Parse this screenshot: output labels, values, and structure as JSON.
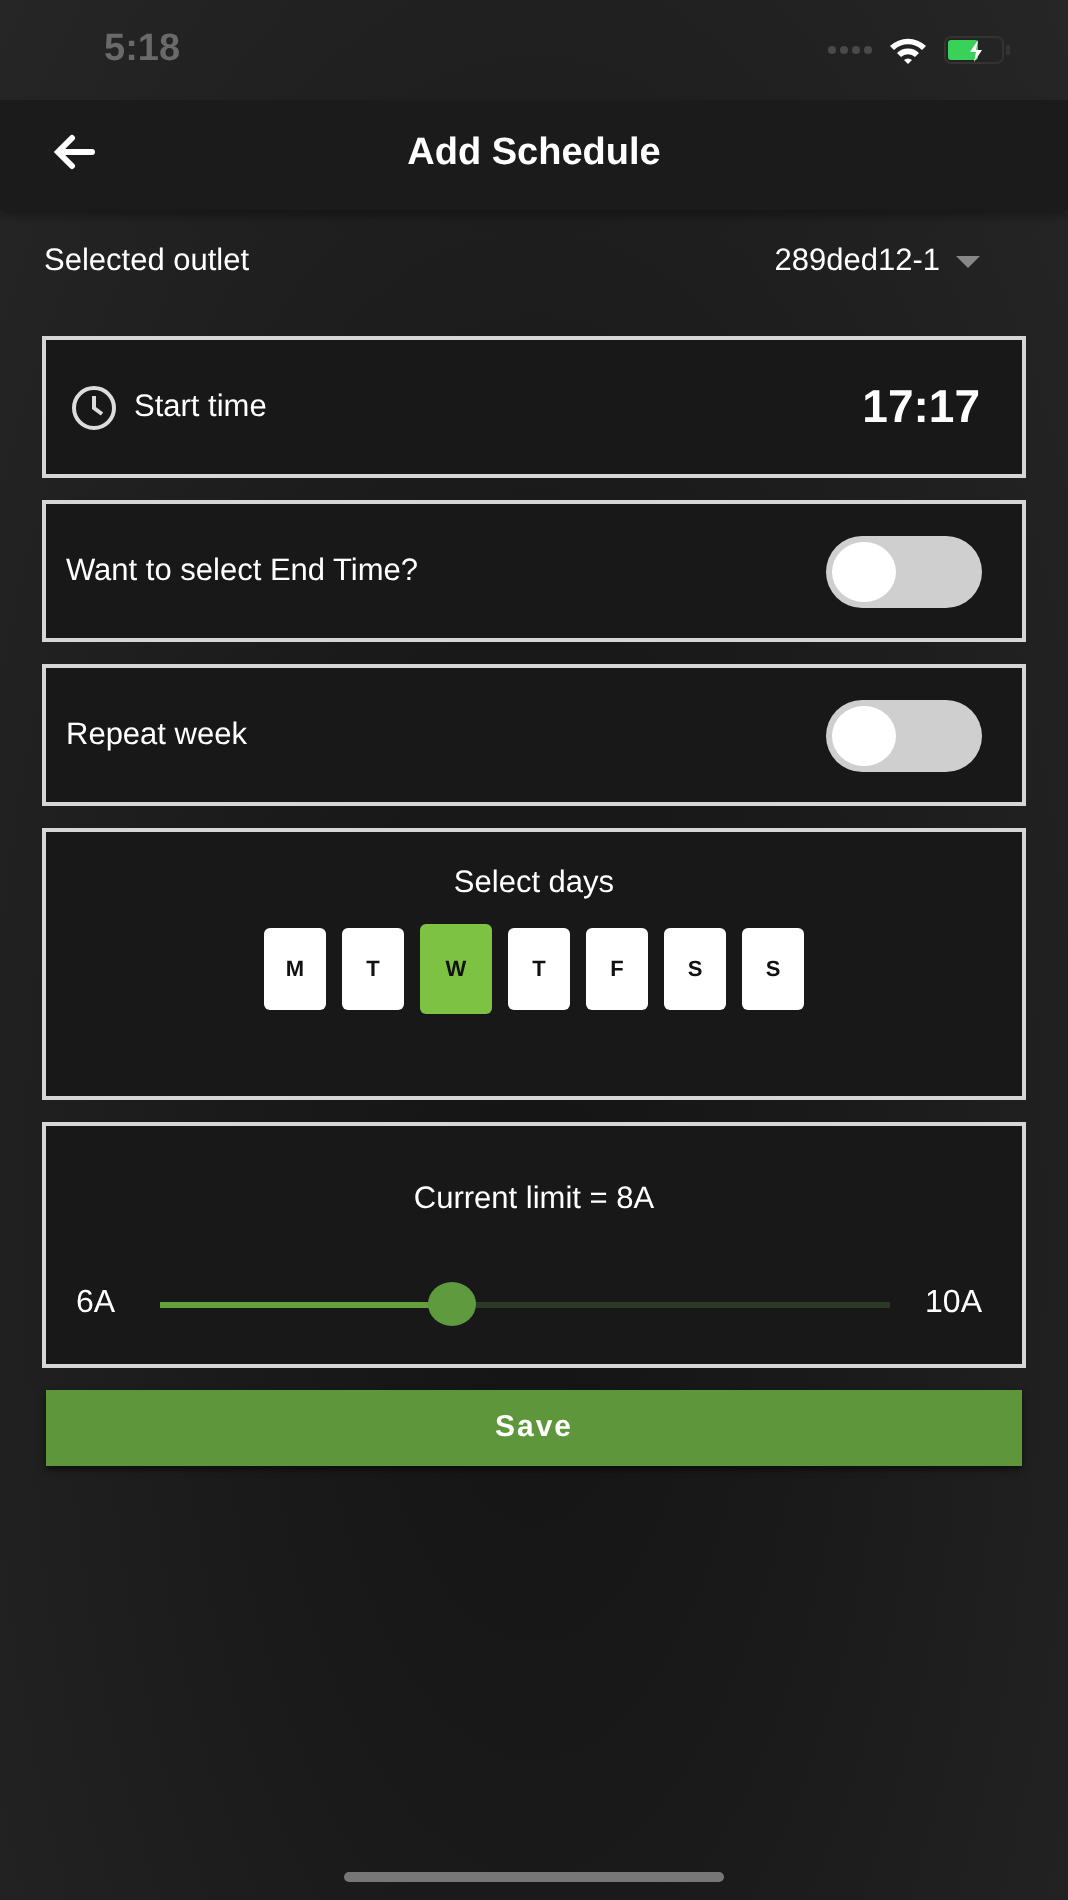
{
  "status_bar": {
    "time": "5:18"
  },
  "header": {
    "title": "Add Schedule"
  },
  "outlet": {
    "label": "Selected outlet",
    "value": "289ded12-1"
  },
  "start_time": {
    "label": "Start time",
    "value": "17:17"
  },
  "toggles": [
    {
      "label": "Want to select End Time?",
      "on": false
    },
    {
      "label": "Repeat week",
      "on": false
    }
  ],
  "days": {
    "title": "Select days",
    "items": [
      {
        "label": "M",
        "selected": false
      },
      {
        "label": "T",
        "selected": false
      },
      {
        "label": "W",
        "selected": true
      },
      {
        "label": "T",
        "selected": false
      },
      {
        "label": "F",
        "selected": false
      },
      {
        "label": "S",
        "selected": false
      },
      {
        "label": "S",
        "selected": false
      }
    ]
  },
  "current_limit": {
    "title": "Current limit = 8A",
    "min_label": "6A",
    "max_label": "10A",
    "level": 0.4
  },
  "save_button": "Save"
}
